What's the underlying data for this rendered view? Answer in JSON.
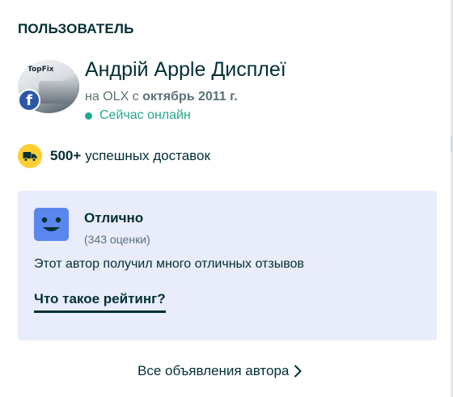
{
  "section": {
    "title": "ПОЛЬЗОВАТЕЛЬ"
  },
  "user": {
    "avatar_logo_text": "TopFix",
    "avatar_badge_icon": "facebook-icon",
    "name": "Андрій Apple Дисплеї",
    "since_prefix": "на OLX с",
    "since_date": "октябрь 2011 г.",
    "online_status": "Сейчас онлайн",
    "online_color": "#23a88f"
  },
  "delivery": {
    "icon": "truck-icon",
    "count": "500+",
    "label": "успешных доставок",
    "icon_bg": "#ffce32"
  },
  "rating": {
    "icon": "smiling-face-icon",
    "title": "Отлично",
    "count": "(343 оценки)",
    "description": "Этот автор получил много отличных отзывов",
    "link": "Что такое рейтинг?",
    "card_bg": "#e8ecfb",
    "icon_bg": "#5a86ee"
  },
  "footer": {
    "all_ads_link": "Все объявления автора",
    "icon": "chevron-right-icon"
  }
}
